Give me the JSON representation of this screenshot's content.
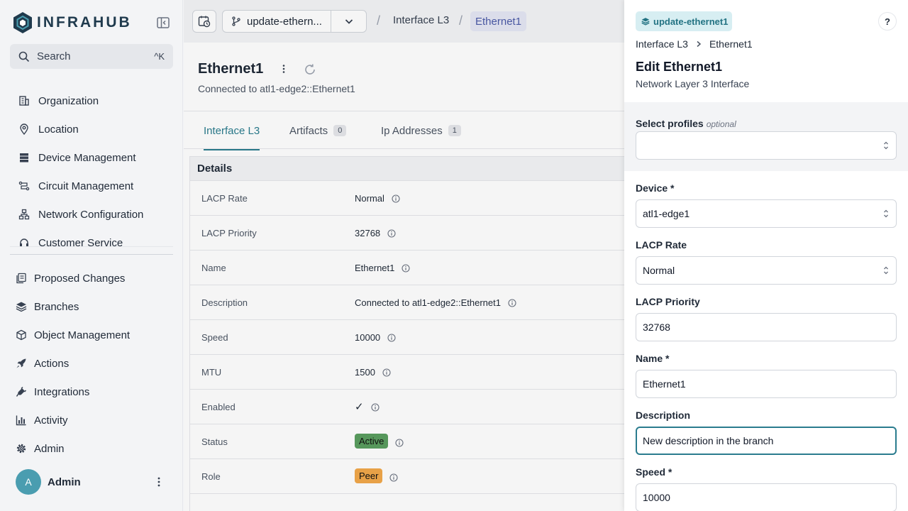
{
  "sidebar": {
    "brand": "INFRAHUB",
    "search_label": "Search",
    "search_shortcut": "^K",
    "top_items": [
      {
        "label": "Organization",
        "icon": "building-icon"
      },
      {
        "label": "Location",
        "icon": "map-pin-icon"
      },
      {
        "label": "Device Management",
        "icon": "server-icon"
      },
      {
        "label": "Circuit Management",
        "icon": "circuit-icon"
      },
      {
        "label": "Network Configuration",
        "icon": "network-icon"
      },
      {
        "label": "Customer Service",
        "icon": "headset-icon"
      }
    ],
    "bottom_items": [
      {
        "label": "Proposed Changes",
        "icon": "proposed-changes-icon"
      },
      {
        "label": "Branches",
        "icon": "layers-icon"
      },
      {
        "label": "Object Management",
        "icon": "box-icon"
      },
      {
        "label": "Actions",
        "icon": "rocket-icon"
      },
      {
        "label": "Integrations",
        "icon": "plug-icon"
      },
      {
        "label": "Activity",
        "icon": "bar-chart-icon"
      },
      {
        "label": "Admin",
        "icon": "gear-icon"
      }
    ],
    "user": {
      "initial": "A",
      "name": "Admin"
    }
  },
  "topbar": {
    "branch": "update-ethern...",
    "breadcrumb": [
      "Interface L3",
      "Ethernet1"
    ]
  },
  "object": {
    "title": "Ethernet1",
    "subtitle": "Connected to atl1-edge2::Ethernet1",
    "tabs": [
      {
        "label": "Interface L3",
        "count": null
      },
      {
        "label": "Artifacts",
        "count": "0"
      },
      {
        "label": "Ip Addresses",
        "count": "1"
      }
    ],
    "details_title": "Details",
    "rows": [
      {
        "key": "LACP Rate",
        "value": "Normal"
      },
      {
        "key": "LACP Priority",
        "value": "32768"
      },
      {
        "key": "Name",
        "value": "Ethernet1"
      },
      {
        "key": "Description",
        "value": "Connected to atl1-edge2::Ethernet1"
      },
      {
        "key": "Speed",
        "value": "10000"
      },
      {
        "key": "MTU",
        "value": "1500"
      },
      {
        "key": "Enabled",
        "value": "✓"
      },
      {
        "key": "Status",
        "value": "Active"
      },
      {
        "key": "Role",
        "value": "Peer"
      }
    ]
  },
  "drawer": {
    "branch": "update-ethernet1",
    "help": "?",
    "crumbs": [
      "Interface L3",
      "Ethernet1"
    ],
    "title": "Edit Ethernet1",
    "subtitle": "Network Layer 3 Interface",
    "profiles_label": "Select profiles",
    "profiles_optional": "optional",
    "fields": [
      {
        "label": "Device *",
        "value": "atl1-edge1",
        "type": "select"
      },
      {
        "label": "LACP Rate",
        "value": "Normal",
        "type": "select"
      },
      {
        "label": "LACP Priority",
        "value": "32768",
        "type": "input"
      },
      {
        "label": "Name *",
        "value": "Ethernet1",
        "type": "input"
      },
      {
        "label": "Description",
        "value": "New description in the branch",
        "type": "input"
      },
      {
        "label": "Speed *",
        "value": "10000",
        "type": "input"
      }
    ]
  },
  "colors": {
    "accent": "#2a7c8e",
    "status_active": "#5a9e5f",
    "role_peer": "#f2a84a"
  }
}
